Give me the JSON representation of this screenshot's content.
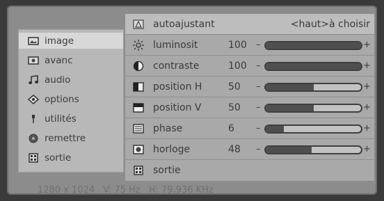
{
  "left_menu": {
    "items": [
      {
        "label": "image",
        "icon": "image-icon",
        "selected": true
      },
      {
        "label": "avanc",
        "icon": "advanced-icon",
        "selected": false
      },
      {
        "label": "audio",
        "icon": "music-note-icon",
        "selected": false
      },
      {
        "label": "options",
        "icon": "options-icon",
        "selected": false
      },
      {
        "label": "utilités",
        "icon": "utilities-icon",
        "selected": false
      },
      {
        "label": "remettre",
        "icon": "reset-icon",
        "selected": false
      },
      {
        "label": "sortie",
        "icon": "exit-icon",
        "selected": false
      }
    ]
  },
  "right_panel": {
    "header": {
      "label": "autoajustant",
      "hint": "<haut>à choisir",
      "icon": "auto-adjust-icon"
    },
    "settings": [
      {
        "label": "luminosit",
        "value": "100",
        "level": 1.0,
        "icon": "brightness-icon"
      },
      {
        "label": "contraste",
        "value": "100",
        "level": 1.0,
        "icon": "contrast-icon"
      },
      {
        "label": "position H",
        "value": "50",
        "level": 0.5,
        "icon": "h-position-icon"
      },
      {
        "label": "position V",
        "value": "50",
        "level": 0.5,
        "icon": "v-position-icon"
      },
      {
        "label": "phase",
        "value": "6",
        "level": 0.19,
        "icon": "phase-icon"
      },
      {
        "label": "horloge",
        "value": "48",
        "level": 0.48,
        "icon": "clock-icon"
      }
    ],
    "footer": {
      "label": "sortie",
      "icon": "exit-icon"
    },
    "minus_symbol": "–",
    "plus_symbol": "+"
  },
  "status": {
    "resolution": "1280 x 1024",
    "vfreq": "V: 75 Hz",
    "hfreq": "H: 79.936 KHz"
  },
  "colors": {
    "osd_bg": "#8c8c8c",
    "panel_bg": "#a9a9a9",
    "selected_bg": "#d8d8d8",
    "slider_fill": "#4f4f4f"
  }
}
